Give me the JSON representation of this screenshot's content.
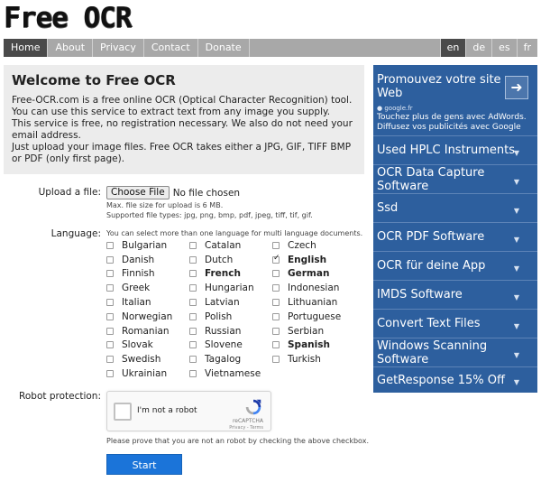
{
  "logo": "Free OCR",
  "nav": {
    "items": [
      "Home",
      "About",
      "Privacy",
      "Contact",
      "Donate"
    ],
    "langs": [
      "en",
      "de",
      "es",
      "fr"
    ]
  },
  "welcome": {
    "title": "Welcome to Free OCR",
    "p1": "Free-OCR.com is a free online OCR (Optical Character Recognition) tool. You can use this service to extract text from any image you supply.",
    "p2": "This service is free, no registration necessary. We also do not need your email address.",
    "p3": "Just upload your image files. Free OCR takes either a JPG, GIF, TIFF BMP or PDF (only first page)."
  },
  "upload": {
    "label": "Upload a file:",
    "button": "Choose File",
    "status": "No file chosen",
    "max_size": "Max. file size for upload is 6 MB.",
    "types": "Supported file types: jpg, png, bmp, pdf, jpeg, tiff, tif, gif."
  },
  "language": {
    "label": "Language:",
    "hint": "You can select more than one language for multi language documents.",
    "columns": [
      [
        {
          "name": "Bulgarian",
          "checked": false,
          "bold": false
        },
        {
          "name": "Danish",
          "checked": false,
          "bold": false
        },
        {
          "name": "Finnish",
          "checked": false,
          "bold": false
        },
        {
          "name": "Greek",
          "checked": false,
          "bold": false
        },
        {
          "name": "Italian",
          "checked": false,
          "bold": false
        },
        {
          "name": "Norwegian",
          "checked": false,
          "bold": false
        },
        {
          "name": "Romanian",
          "checked": false,
          "bold": false
        },
        {
          "name": "Slovak",
          "checked": false,
          "bold": false
        },
        {
          "name": "Swedish",
          "checked": false,
          "bold": false
        },
        {
          "name": "Ukrainian",
          "checked": false,
          "bold": false
        }
      ],
      [
        {
          "name": "Catalan",
          "checked": false,
          "bold": false
        },
        {
          "name": "Dutch",
          "checked": false,
          "bold": false
        },
        {
          "name": "French",
          "checked": false,
          "bold": true
        },
        {
          "name": "Hungarian",
          "checked": false,
          "bold": false
        },
        {
          "name": "Latvian",
          "checked": false,
          "bold": false
        },
        {
          "name": "Polish",
          "checked": false,
          "bold": false
        },
        {
          "name": "Russian",
          "checked": false,
          "bold": false
        },
        {
          "name": "Slovene",
          "checked": false,
          "bold": false
        },
        {
          "name": "Tagalog",
          "checked": false,
          "bold": false
        },
        {
          "name": "Vietnamese",
          "checked": false,
          "bold": false
        }
      ],
      [
        {
          "name": "Czech",
          "checked": false,
          "bold": false
        },
        {
          "name": "English",
          "checked": true,
          "bold": true
        },
        {
          "name": "German",
          "checked": false,
          "bold": true
        },
        {
          "name": "Indonesian",
          "checked": false,
          "bold": false
        },
        {
          "name": "Lithuanian",
          "checked": false,
          "bold": false
        },
        {
          "name": "Portuguese",
          "checked": false,
          "bold": false
        },
        {
          "name": "Serbian",
          "checked": false,
          "bold": false
        },
        {
          "name": "Spanish",
          "checked": false,
          "bold": true
        },
        {
          "name": "Turkish",
          "checked": false,
          "bold": false
        }
      ]
    ]
  },
  "robot": {
    "label": "Robot protection:",
    "captcha_text": "I'm not a robot",
    "captcha_brand": "reCAPTCHA",
    "captcha_links": "Privacy - Terms",
    "note": "Please prove that you are not an robot by checking the above checkbox."
  },
  "start_button": "Start",
  "ads": {
    "headline": "Promouvez votre site Web",
    "source": "google.fr",
    "description": "Touchez plus de gens avec AdWords. Diffusez vos publicités avec Google",
    "links": [
      "Used HPLC Instruments",
      "OCR Data Capture Software",
      "Ssd",
      "OCR PDF Software",
      "OCR für deine App",
      "IMDS Software",
      "Convert Text Files",
      "Windows Scanning Software",
      "GetResponse 15% Off"
    ]
  },
  "colors": {
    "nav_bg": "#a8a8a8",
    "nav_active": "#4a4a4a",
    "ad_bg": "#2d5f9e",
    "start_button": "#1b74d9"
  }
}
